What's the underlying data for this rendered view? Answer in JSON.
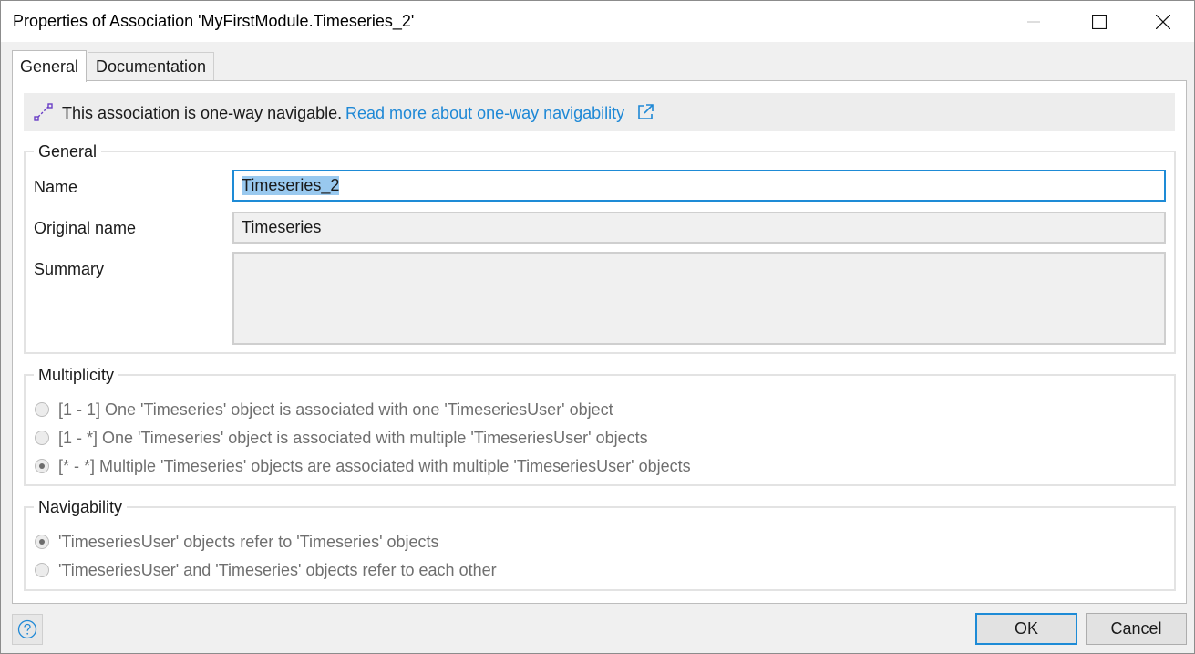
{
  "window": {
    "title": "Properties of Association 'MyFirstModule.Timeseries_2'"
  },
  "tabs": [
    {
      "label": "General",
      "active": true
    },
    {
      "label": "Documentation",
      "active": false
    }
  ],
  "info": {
    "message": "This association is one-way navigable.",
    "link_text": "Read more about one-way navigability",
    "icon": "association-icon",
    "link_icon": "external-link-icon"
  },
  "general": {
    "legend": "General",
    "name_label": "Name",
    "name_value": "Timeseries_2",
    "original_name_label": "Original name",
    "original_name_value": "Timeseries",
    "summary_label": "Summary",
    "summary_value": ""
  },
  "multiplicity": {
    "legend": "Multiplicity",
    "options": [
      {
        "label": "[1 - 1] One 'Timeseries' object is associated with one 'TimeseriesUser' object",
        "checked": false
      },
      {
        "label": "[1 - *] One 'Timeseries' object is associated with multiple 'TimeseriesUser' objects",
        "checked": false
      },
      {
        "label": "[* - *] Multiple 'Timeseries' objects are associated with multiple 'TimeseriesUser' objects",
        "checked": true
      }
    ]
  },
  "navigability": {
    "legend": "Navigability",
    "options": [
      {
        "label": "'TimeseriesUser' objects refer to 'Timeseries' objects",
        "checked": true
      },
      {
        "label": "'TimeseriesUser' and 'Timeseries' objects refer to each other",
        "checked": false
      }
    ]
  },
  "footer": {
    "help_icon": "help-icon",
    "ok_label": "OK",
    "cancel_label": "Cancel"
  },
  "colors": {
    "accent": "#1e8bd6",
    "link": "#1e88d6",
    "selection": "#99c9ef",
    "association_icon": "#6a3fc7"
  }
}
